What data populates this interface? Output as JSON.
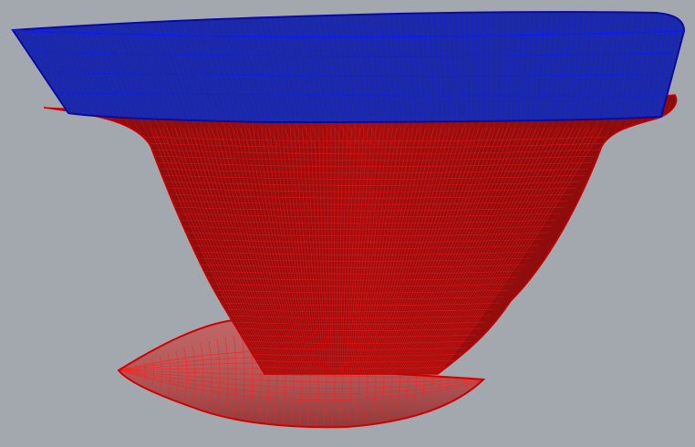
{
  "viewport": {
    "background": "#a3a8ae",
    "objects": [
      {
        "name": "deck-slab",
        "fill": "#1c2aa6",
        "wire": "#0a1cff",
        "edge": "#0a0aa0"
      },
      {
        "name": "hull-body",
        "fill": "#a30f0f",
        "wire": "#ff1a1a",
        "edge": "#cc0000"
      },
      {
        "name": "bulb-pod",
        "fill": "#b64a4a",
        "wire": "#ff2020",
        "edge": "#d00000"
      }
    ]
  }
}
